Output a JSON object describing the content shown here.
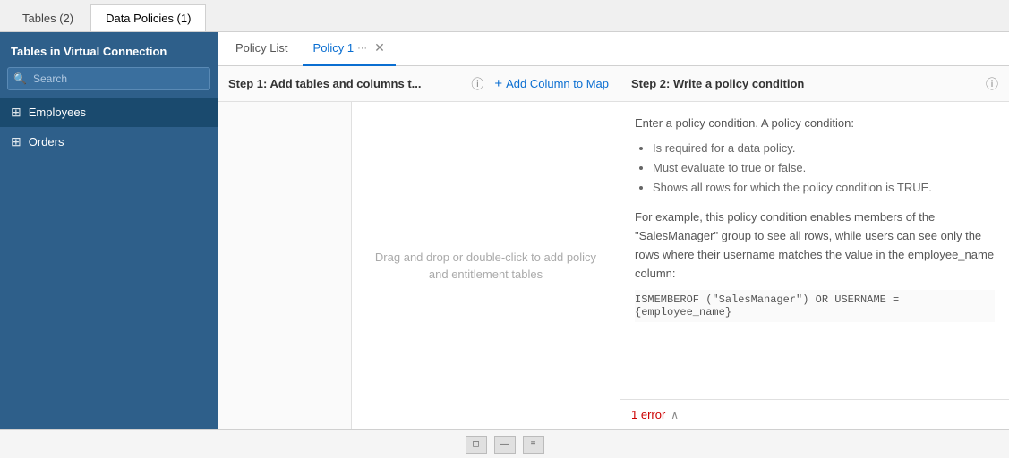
{
  "sidebar": {
    "title": "Tables in Virtual Connection",
    "search_placeholder": "Search",
    "items": [
      {
        "id": "employees",
        "label": "Employees",
        "icon": "⊞",
        "active": true
      },
      {
        "id": "orders",
        "label": "Orders",
        "icon": "⊞",
        "active": false
      }
    ]
  },
  "top_tabs": [
    {
      "id": "tables",
      "label": "Tables (2)",
      "active": false
    },
    {
      "id": "data-policies",
      "label": "Data Policies (1)",
      "active": true
    }
  ],
  "policy_tabs": [
    {
      "id": "policy-list",
      "label": "Policy List",
      "active": false
    },
    {
      "id": "policy-1",
      "label": "Policy 1",
      "active": true
    }
  ],
  "step1": {
    "header": "Step 1: Add tables and columns t...",
    "add_column_label": "Add Column to Map",
    "drag_hint_line1": "Drag and drop or double-click to add policy",
    "drag_hint_line2": "and entitlement tables"
  },
  "step2": {
    "header": "Step 2: Write a policy condition",
    "intro": "Enter a policy condition. A policy condition:",
    "bullets": [
      "Is required for a data policy.",
      "Must evaluate to true or false.",
      "Shows all rows for which the policy condition is TRUE."
    ],
    "example_text": "For example, this policy condition enables members of the \"SalesManager\" group to see all rows, while users can see only the rows where their username matches the value in the employee_name column:",
    "code": "ISMEMBEROF (\"SalesManager\") OR USERNAME =\n{employee_name}"
  },
  "error_bar": {
    "error_text": "1 error",
    "chevron": "∧"
  }
}
